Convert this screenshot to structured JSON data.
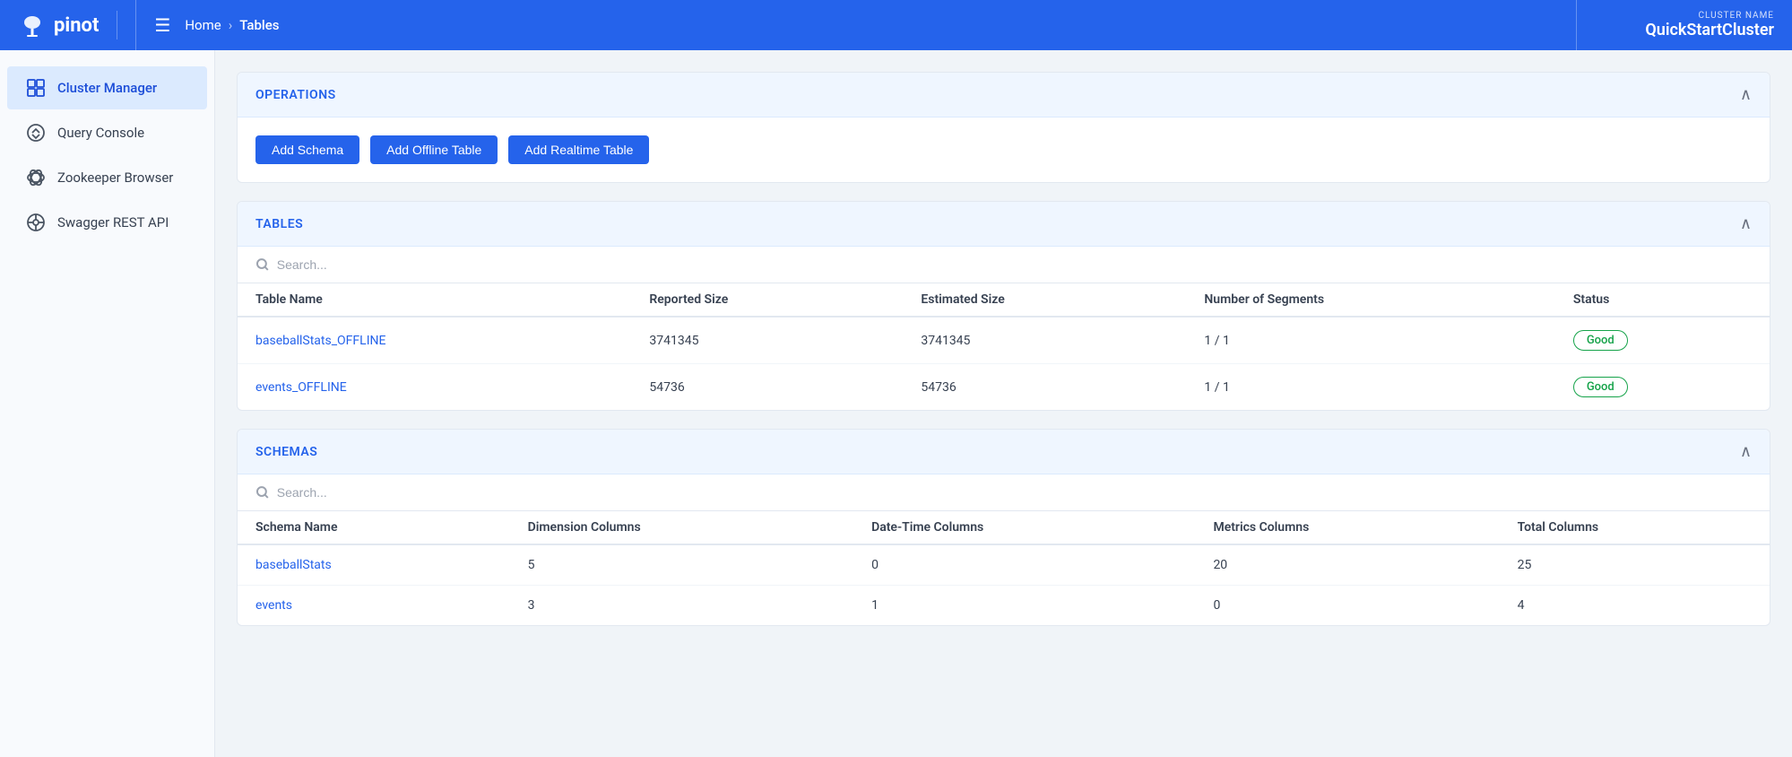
{
  "app": {
    "logo_text": "pinot",
    "cluster_label": "CLUSTER NAME",
    "cluster_name": "QuickStartCluster"
  },
  "nav": {
    "menu_icon": "☰",
    "home_label": "Home",
    "separator": "›",
    "current_label": "Tables"
  },
  "sidebar": {
    "items": [
      {
        "id": "cluster-manager",
        "label": "Cluster Manager",
        "icon": "cluster",
        "active": true
      },
      {
        "id": "query-console",
        "label": "Query Console",
        "icon": "query",
        "active": false
      },
      {
        "id": "zookeeper-browser",
        "label": "Zookeeper Browser",
        "icon": "zookeeper",
        "active": false
      },
      {
        "id": "swagger-rest-api",
        "label": "Swagger REST API",
        "icon": "swagger",
        "active": false
      }
    ]
  },
  "operations": {
    "section_title": "OPERATIONS",
    "buttons": [
      {
        "id": "add-schema",
        "label": "Add Schema"
      },
      {
        "id": "add-offline-table",
        "label": "Add Offline Table"
      },
      {
        "id": "add-realtime-table",
        "label": "Add Realtime Table"
      }
    ]
  },
  "tables": {
    "section_title": "TABLES",
    "search_placeholder": "Search...",
    "columns": [
      "Table Name",
      "Reported Size",
      "Estimated Size",
      "Number of Segments",
      "Status"
    ],
    "rows": [
      {
        "name": "baseballStats_OFFLINE",
        "reported_size": "3741345",
        "estimated_size": "3741345",
        "segments": "1 / 1",
        "status": "Good"
      },
      {
        "name": "events_OFFLINE",
        "reported_size": "54736",
        "estimated_size": "54736",
        "segments": "1 / 1",
        "status": "Good"
      }
    ]
  },
  "schemas": {
    "section_title": "SCHEMAS",
    "search_placeholder": "Search...",
    "columns": [
      "Schema Name",
      "Dimension Columns",
      "Date-Time Columns",
      "Metrics Columns",
      "Total Columns"
    ],
    "rows": [
      {
        "name": "baseballStats",
        "dimension": "5",
        "datetime": "0",
        "metrics": "20",
        "total": "25"
      },
      {
        "name": "events",
        "dimension": "3",
        "datetime": "1",
        "metrics": "0",
        "total": "4"
      }
    ]
  }
}
